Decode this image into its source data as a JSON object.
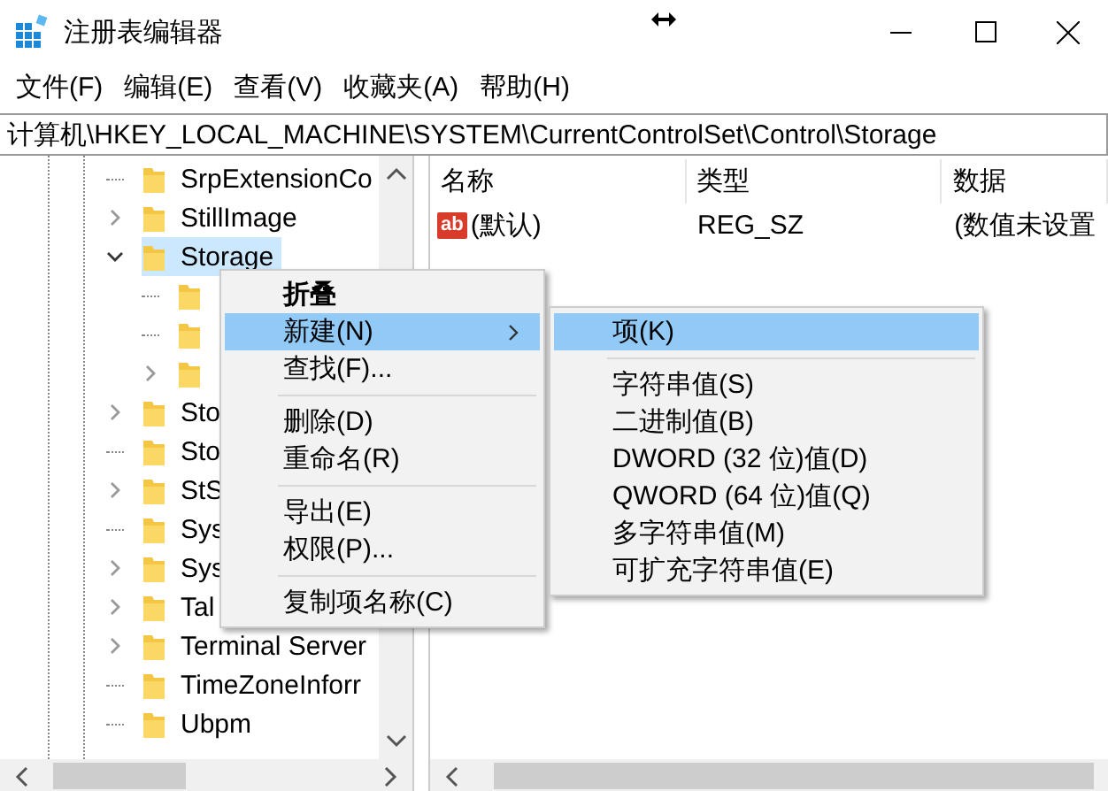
{
  "window": {
    "title": "注册表编辑器"
  },
  "menu_bar": [
    "文件(F)",
    "编辑(E)",
    "查看(V)",
    "收藏夹(A)",
    "帮助(H)"
  ],
  "address": "计算机\\HKEY_LOCAL_MACHINE\\SYSTEM\\CurrentControlSet\\Control\\Storage",
  "tree": [
    {
      "label": "SrpExtensionCo",
      "has_children": false,
      "selected": false
    },
    {
      "label": "StillImage",
      "has_children": true,
      "expanded": false,
      "selected": false
    },
    {
      "label": "Storage",
      "has_children": true,
      "expanded": true,
      "selected": true,
      "children": [
        {
          "has_children": false,
          "selected": false
        },
        {
          "has_children": false,
          "selected": false
        },
        {
          "has_children": true,
          "expanded": false,
          "selected": false
        }
      ]
    },
    {
      "label": "Sto",
      "has_children": true,
      "expanded": false,
      "selected": false
    },
    {
      "label": "Sto",
      "has_children": false,
      "selected": false
    },
    {
      "label": "StS",
      "has_children": true,
      "expanded": false,
      "selected": false
    },
    {
      "label": "Sys",
      "has_children": false,
      "selected": false
    },
    {
      "label": "Sys",
      "has_children": true,
      "expanded": false,
      "selected": false
    },
    {
      "label": "Tal",
      "has_children": true,
      "expanded": false,
      "selected": false
    },
    {
      "label": "Terminal Server",
      "has_children": true,
      "expanded": false,
      "selected": false
    },
    {
      "label": "TimeZoneInforr",
      "has_children": false,
      "selected": false
    },
    {
      "label": "Ubpm",
      "has_children": false,
      "selected": false
    }
  ],
  "values_table": {
    "columns": [
      "名称",
      "类型",
      "数据"
    ],
    "rows": [
      {
        "icon_text": "ab",
        "name": "(默认)",
        "type": "REG_SZ",
        "data": "(数值未设置"
      }
    ]
  },
  "context_menu": [
    {
      "kind": "item",
      "label": "折叠",
      "bold": true,
      "selected": false,
      "submenu": false
    },
    {
      "kind": "item",
      "label": "新建(N)",
      "bold": false,
      "selected": true,
      "submenu": true
    },
    {
      "kind": "item",
      "label": "查找(F)...",
      "bold": false,
      "selected": false,
      "submenu": false
    },
    {
      "kind": "separator"
    },
    {
      "kind": "item",
      "label": "删除(D)",
      "bold": false,
      "selected": false,
      "submenu": false
    },
    {
      "kind": "item",
      "label": "重命名(R)",
      "bold": false,
      "selected": false,
      "submenu": false
    },
    {
      "kind": "separator"
    },
    {
      "kind": "item",
      "label": "导出(E)",
      "bold": false,
      "selected": false,
      "submenu": false
    },
    {
      "kind": "item",
      "label": "权限(P)...",
      "bold": false,
      "selected": false,
      "submenu": false
    },
    {
      "kind": "separator"
    },
    {
      "kind": "item",
      "label": "复制项名称(C)",
      "bold": false,
      "selected": false,
      "submenu": false
    }
  ],
  "submenu": [
    {
      "kind": "item",
      "label": "项(K)",
      "selected": true
    },
    {
      "kind": "separator"
    },
    {
      "kind": "item",
      "label": "字符串值(S)",
      "selected": false
    },
    {
      "kind": "item",
      "label": "二进制值(B)",
      "selected": false
    },
    {
      "kind": "item",
      "label": "DWORD (32 位)值(D)",
      "selected": false
    },
    {
      "kind": "item",
      "label": "QWORD (64 位)值(Q)",
      "selected": false
    },
    {
      "kind": "item",
      "label": "多字符串值(M)",
      "selected": false
    },
    {
      "kind": "item",
      "label": "可扩充字符串值(E)",
      "selected": false
    }
  ]
}
